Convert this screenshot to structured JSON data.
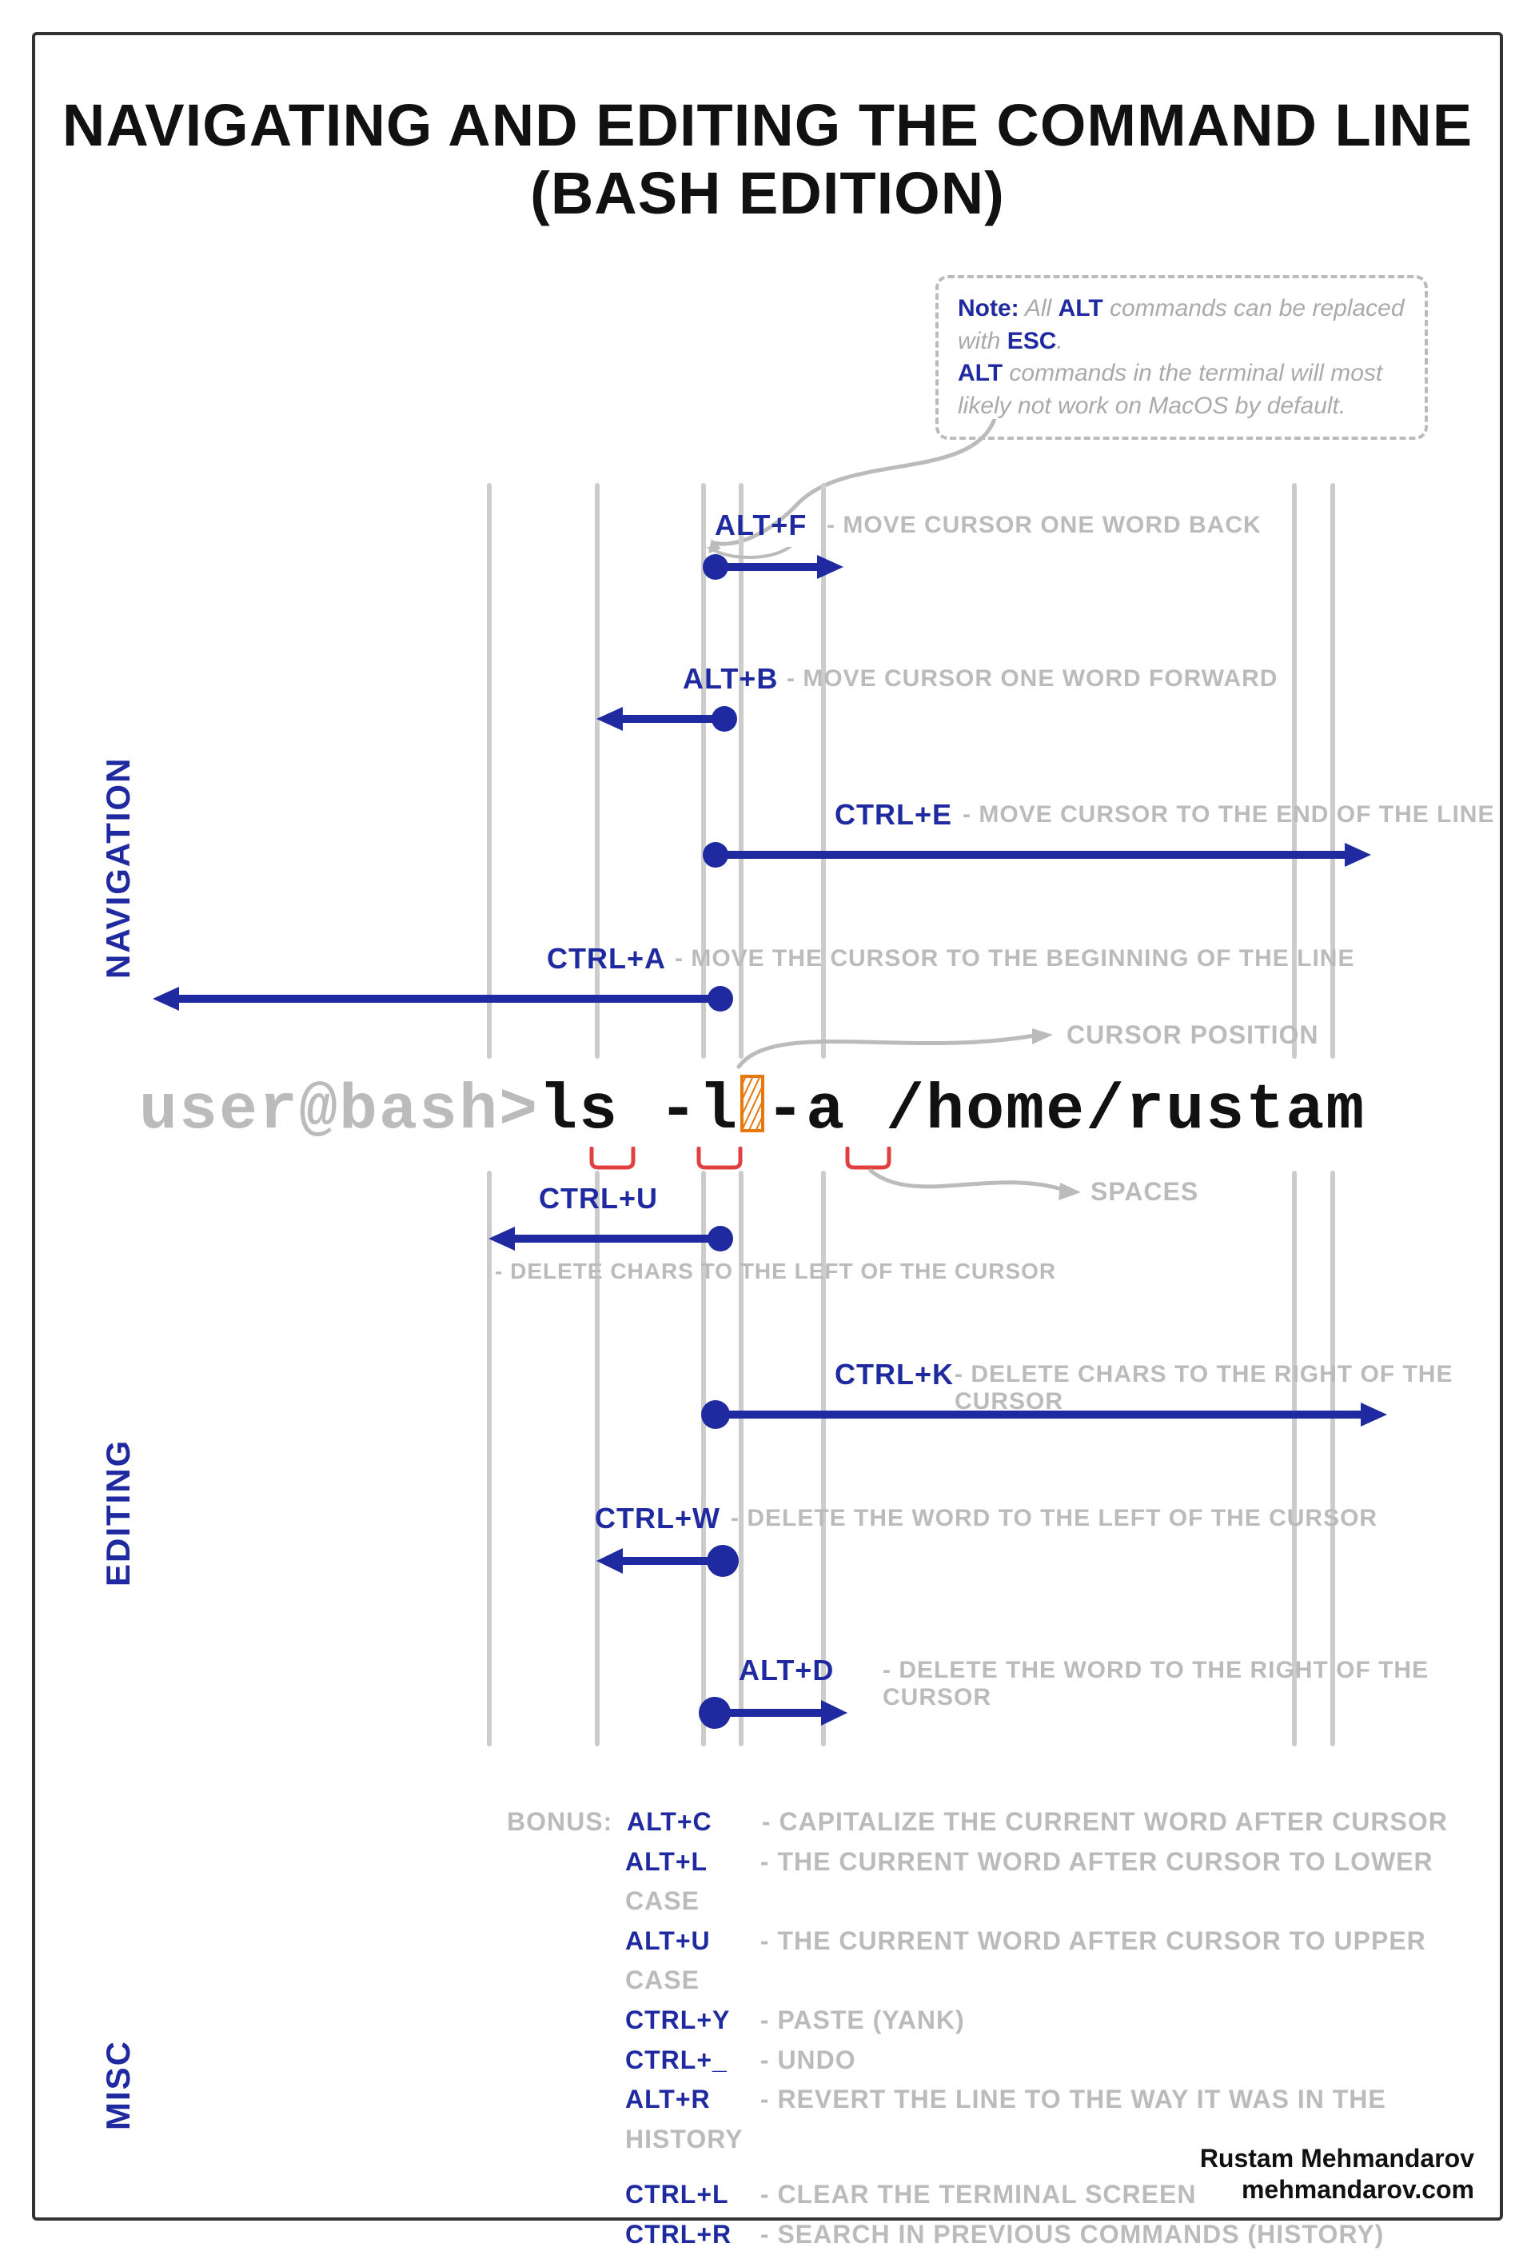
{
  "title_line1": "NAVIGATING AND EDITING THE COMMAND LINE",
  "title_line2": "(BASH EDITION)",
  "note": {
    "prefix": "Note:",
    "part1_a": " All ",
    "kw_alt": "ALT",
    "part1_b": " commands can be replaced with ",
    "kw_esc": "ESC",
    "part1_c": ".",
    "part2_a": "ALT",
    "part2_b": " commands in the terminal will most likely not work on MacOS by default."
  },
  "sections": {
    "navigation": "NAVIGATION",
    "editing": "EDITING",
    "misc": "MISC"
  },
  "prompt": "user@bash>",
  "command": "ls -l",
  "command_after": "-a /home/rustam",
  "cursor_pos_label": "CURSOR POSITION",
  "spaces_label": "SPACES",
  "nav": {
    "alt_f": {
      "kbd": "ALT+F",
      "desc": "- MOVE CURSOR ONE WORD BACK"
    },
    "alt_b": {
      "kbd": "ALT+B",
      "desc": "- MOVE CURSOR ONE WORD FORWARD"
    },
    "ctrl_e": {
      "kbd": "CTRL+E",
      "desc": "- MOVE CURSOR TO THE END OF THE LINE"
    },
    "ctrl_a": {
      "kbd": "CTRL+A",
      "desc": "- MOVE THE CURSOR TO THE BEGINNING OF THE LINE"
    }
  },
  "edit": {
    "ctrl_u": {
      "kbd": "CTRL+U",
      "desc": "- DELETE CHARS TO THE LEFT OF THE CURSOR"
    },
    "ctrl_k": {
      "kbd": "CTRL+K",
      "desc": "- DELETE CHARS TO THE RIGHT OF THE CURSOR"
    },
    "ctrl_w": {
      "kbd": "CTRL+W",
      "desc": "- DELETE THE WORD TO THE LEFT OF THE CURSOR"
    },
    "alt_d": {
      "kbd": "ALT+D",
      "desc": "- DELETE THE WORD TO THE RIGHT OF THE CURSOR"
    }
  },
  "bonus_label": "BONUS:",
  "bonus": [
    {
      "kbd": "ALT+C",
      "desc": "- CAPITALIZE THE CURRENT WORD AFTER CURSOR"
    },
    {
      "kbd": "ALT+L",
      "desc": "- THE CURRENT WORD AFTER CURSOR TO LOWER CASE"
    },
    {
      "kbd": "ALT+U",
      "desc": "- THE CURRENT WORD AFTER CURSOR TO UPPER CASE"
    },
    {
      "kbd": "CTRL+Y",
      "desc": "- PASTE (YANK)"
    },
    {
      "kbd": "CTRL+_",
      "desc": "- UNDO"
    },
    {
      "kbd": "ALT+R",
      "desc": "- REVERT THE LINE TO THE WAY IT WAS IN THE HISTORY"
    }
  ],
  "misc": [
    {
      "kbd": "CTRL+L",
      "desc": "- CLEAR THE TERMINAL SCREEN"
    },
    {
      "kbd": "CTRL+R",
      "desc": "- SEARCH IN PREVIOUS COMMANDS (HISTORY)"
    }
  ],
  "credit_name": "Rustam Mehmandarov",
  "credit_site": "mehmandarov.com"
}
